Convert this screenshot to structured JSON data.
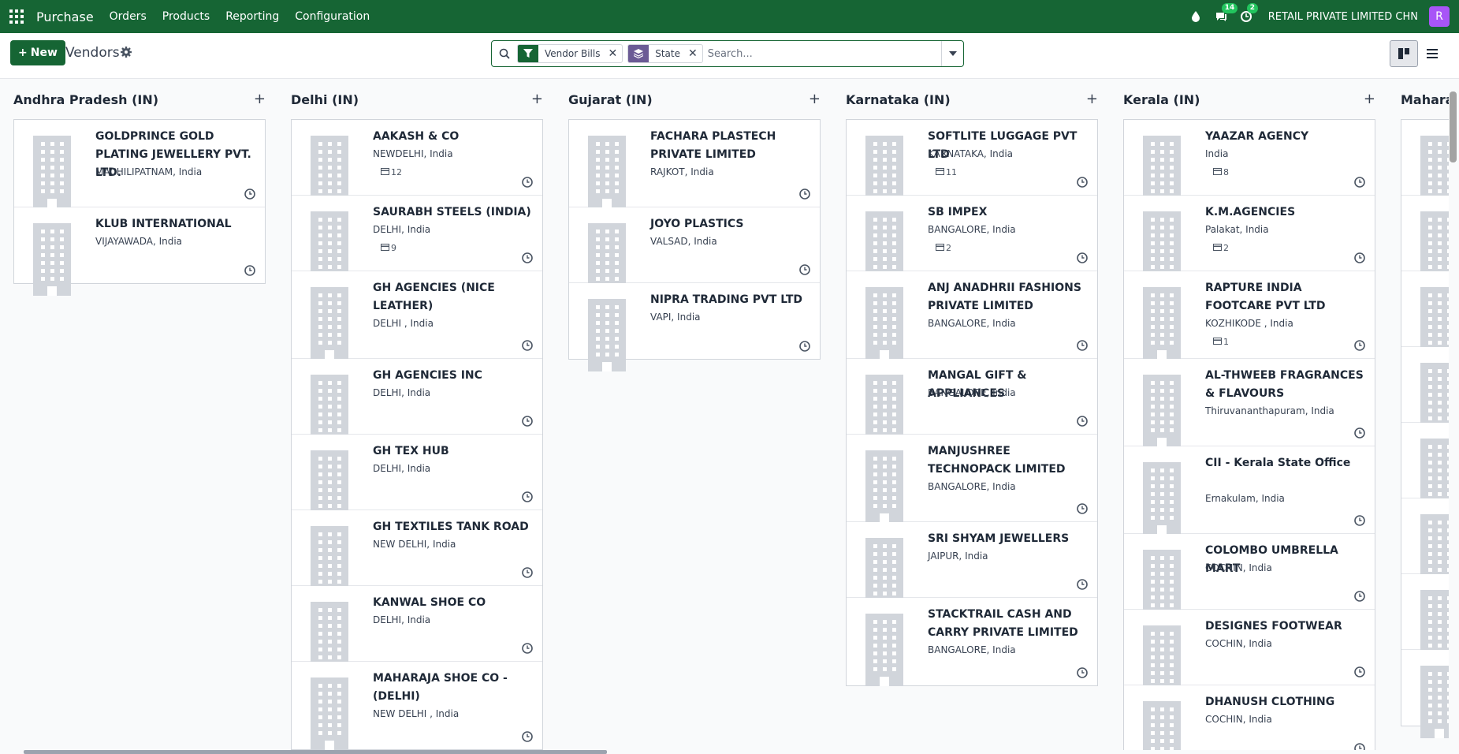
{
  "navbar": {
    "brand": "Purchase",
    "menu": [
      "Orders",
      "Products",
      "Reporting",
      "Configuration"
    ],
    "messages_count": "14",
    "activities_count": "2",
    "company": "RETAIL PRIVATE LIMITED CHN",
    "avatar_letter": "R"
  },
  "control": {
    "new_label": "New",
    "title": "Vendors",
    "facets": [
      "Vendor Bills",
      "State"
    ],
    "search_placeholder": "Search..."
  },
  "columns": [
    {
      "title": "Andhra Pradesh (IN)",
      "cards": [
        {
          "name": "GOLDPRINCE GOLD PLATING JEWELLERY PVT. LTD.",
          "address": "MACHILIPATNAM, India",
          "bills": ""
        },
        {
          "name": "KLUB INTERNATIONAL",
          "address": "VIJAYAWADA, India",
          "bills": ""
        }
      ]
    },
    {
      "title": "Delhi (IN)",
      "cards": [
        {
          "name": "AAKASH & CO",
          "address": "NEWDELHI, India",
          "bills": "12"
        },
        {
          "name": "SAURABH STEELS (INDIA)",
          "address": "DELHI, India",
          "bills": "9"
        },
        {
          "name": "GH AGENCIES (NICE LEATHER)",
          "address": "DELHI , India",
          "bills": ""
        },
        {
          "name": "GH AGENCIES INC",
          "address": "DELHI, India",
          "bills": ""
        },
        {
          "name": "GH TEX HUB",
          "address": "DELHI, India",
          "bills": ""
        },
        {
          "name": "GH TEXTILES TANK ROAD",
          "address": "NEW DELHI, India",
          "bills": ""
        },
        {
          "name": "KANWAL SHOE CO",
          "address": "DELHI, India",
          "bills": ""
        },
        {
          "name": "MAHARAJA SHOE CO - (DELHI)",
          "address": "NEW DELHI , India",
          "bills": ""
        }
      ]
    },
    {
      "title": "Gujarat (IN)",
      "cards": [
        {
          "name": "FACHARA PLASTECH PRIVATE LIMITED",
          "address": "RAJKOT, India",
          "bills": ""
        },
        {
          "name": "JOYO PLASTICS",
          "address": "VALSAD, India",
          "bills": ""
        },
        {
          "name": "NIPRA TRADING PVT LTD",
          "address": "VAPI, India",
          "bills": ""
        }
      ]
    },
    {
      "title": "Karnataka (IN)",
      "cards": [
        {
          "name": "SOFTLITE LUGGAGE PVT LTD",
          "address": "KARNATAKA, India",
          "bills": "11"
        },
        {
          "name": "SB IMPEX",
          "address": "BANGALORE, India",
          "bills": "2"
        },
        {
          "name": "ANJ ANADHRII FASHIONS PRIVATE LIMITED",
          "address": "BANGALORE, India",
          "bills": ""
        },
        {
          "name": "MANGAL GIFT & APPLIANCES",
          "address": "BANGALORE, India",
          "bills": ""
        },
        {
          "name": "MANJUSHREE TECHNOPACK LIMITED",
          "address": "BANGALORE, India",
          "bills": ""
        },
        {
          "name": "SRI SHYAM JEWELLERS",
          "address": "JAIPUR, India",
          "bills": ""
        },
        {
          "name": "STACKTRAIL CASH AND CARRY PRIVATE LIMITED",
          "address": "BANGALORE, India",
          "bills": ""
        }
      ]
    },
    {
      "title": "Kerala (IN)",
      "cards": [
        {
          "name": "YAAZAR AGENCY",
          "address": "India",
          "bills": "8"
        },
        {
          "name": "K.M.AGENCIES",
          "address": "Palakat, India",
          "bills": "2"
        },
        {
          "name": "RAPTURE INDIA FOOTCARE PVT LTD",
          "address": "KOZHIKODE , India",
          "bills": "1"
        },
        {
          "name": "AL-THWEEB FRAGRANCES & FLAVOURS",
          "address": "Thiruvananthapuram, India",
          "bills": ""
        },
        {
          "name": "CII - Kerala State Office",
          "address": "Ernakulam, India",
          "bills": ""
        },
        {
          "name": "COLOMBO UMBRELLA MART",
          "address": "COCHIN, India",
          "bills": ""
        },
        {
          "name": "DESIGNES FOOTWEAR",
          "address": "COCHIN, India",
          "bills": ""
        },
        {
          "name": "DHANUSH CLOTHING",
          "address": "COCHIN, India",
          "bills": ""
        }
      ]
    },
    {
      "title": "Mahara",
      "cards": [
        {
          "name": "",
          "address": "",
          "bills": ""
        },
        {
          "name": "",
          "address": "",
          "bills": ""
        },
        {
          "name": "",
          "address": "",
          "bills": ""
        },
        {
          "name": "",
          "address": "",
          "bills": ""
        },
        {
          "name": "",
          "address": "",
          "bills": ""
        },
        {
          "name": "",
          "address": "",
          "bills": ""
        },
        {
          "name": "",
          "address": "",
          "bills": ""
        },
        {
          "name": "",
          "address": "",
          "bills": ""
        }
      ]
    }
  ]
}
